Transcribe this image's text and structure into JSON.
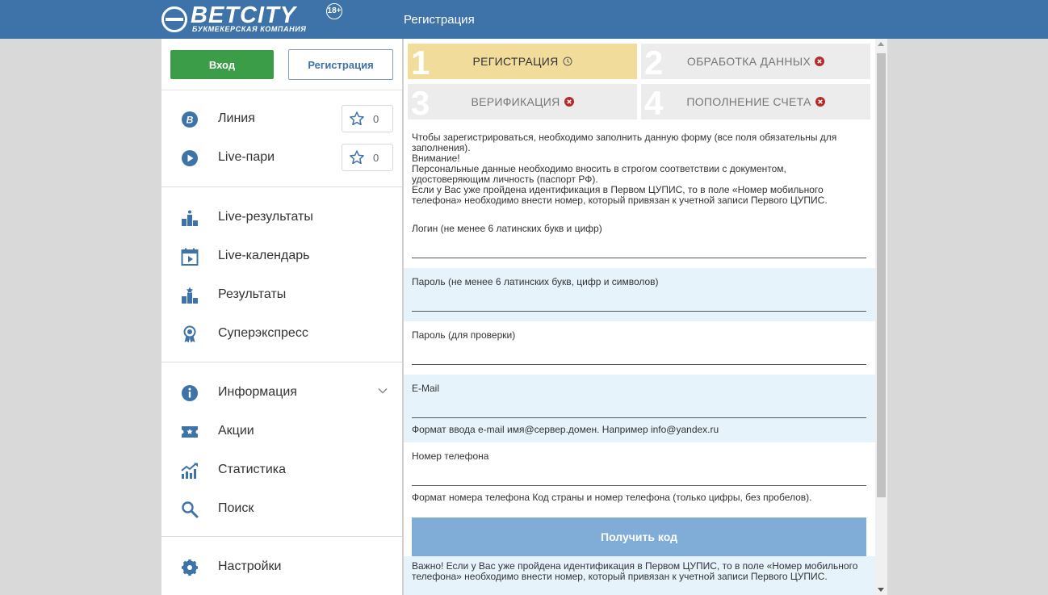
{
  "header": {
    "logo_text": "BETCITY",
    "logo_sub": "БУКМЕКЕРСКАЯ КОМПАНИЯ",
    "logo_age": "18+",
    "title": "Регистрация"
  },
  "auth": {
    "login_label": "Вход",
    "register_label": "Регистрация"
  },
  "sidebar": {
    "group1": [
      {
        "label": "Линия",
        "icon": "bet-circle-icon",
        "fav_count": "0"
      },
      {
        "label": "Live-пари",
        "icon": "play-circle-icon",
        "fav_count": "0"
      }
    ],
    "group2": [
      {
        "label": "Live-результаты",
        "icon": "podium-icon"
      },
      {
        "label": "Live-календарь",
        "icon": "calendar-play-icon"
      },
      {
        "label": "Результаты",
        "icon": "podium-star-icon"
      },
      {
        "label": "Суперэкспресс",
        "icon": "medal-icon"
      }
    ],
    "group3": [
      {
        "label": "Информация",
        "icon": "info-icon"
      },
      {
        "label": "Акции",
        "icon": "ticket-icon"
      },
      {
        "label": "Статистика",
        "icon": "chart-icon"
      },
      {
        "label": "Поиск",
        "icon": "search-icon"
      }
    ],
    "group4": [
      {
        "label": "Настройки",
        "icon": "gear-icon"
      }
    ]
  },
  "steps": [
    {
      "num": "1",
      "label": "РЕГИСТРАЦИЯ",
      "status": "clock-icon"
    },
    {
      "num": "2",
      "label": "ОБРАБОТКА ДАННЫХ",
      "status": "error-icon"
    },
    {
      "num": "3",
      "label": "ВЕРИФИКАЦИЯ",
      "status": "error-icon"
    },
    {
      "num": "4",
      "label": "ПОПОЛНЕНИЕ СЧЕТА",
      "status": "error-icon"
    }
  ],
  "intro": {
    "line1": "Чтобы зарегистрироваться, необходимо заполнить данную форму (все поля обязательны для заполнения).",
    "line2": "Внимание!",
    "line3": "Персональные данные необходимо вносить в строгом соответствии с документом, удостоверяющим личность (паспорт РФ).",
    "line4": "Если у Вас уже пройдена идентификация в Первом ЦУПИС, то в поле «Номер мобильного телефона» необходимо внести номер, который привязан к учетной записи Первого ЦУПИС."
  },
  "form": {
    "login_label": "Логин (не менее 6 латинских букв и цифр)",
    "login_value": "",
    "password_label": "Пароль (не менее 6 латинских букв, цифр и символов)",
    "password_value": "",
    "password2_label": "Пароль (для проверки)",
    "password2_value": "",
    "email_label": "E-Mail",
    "email_value": "",
    "email_hint": "Формат ввода e-mail имя@сервер.домен. Например info@yandex.ru",
    "phone_label": "Номер телефона",
    "phone_value": "",
    "phone_hint": "Формат номера телефона Код страны и номер телефона (только цифры, без пробелов).",
    "get_code_label": "Получить код",
    "note": "Важно! Если у Вас уже пройдена идентификация в Первом ЦУПИС, то в поле «Номер мобильного телефона» необходимо внести номер, который привязан к учетной записи Первого ЦУПИС."
  },
  "colors": {
    "brand": "#3d73a8",
    "login_green": "#3b9d47",
    "active_step": "#f2dc9c",
    "field_blue": "#e6f3fb",
    "button_blue": "#7fadd8",
    "error_red": "#b52b2b"
  }
}
